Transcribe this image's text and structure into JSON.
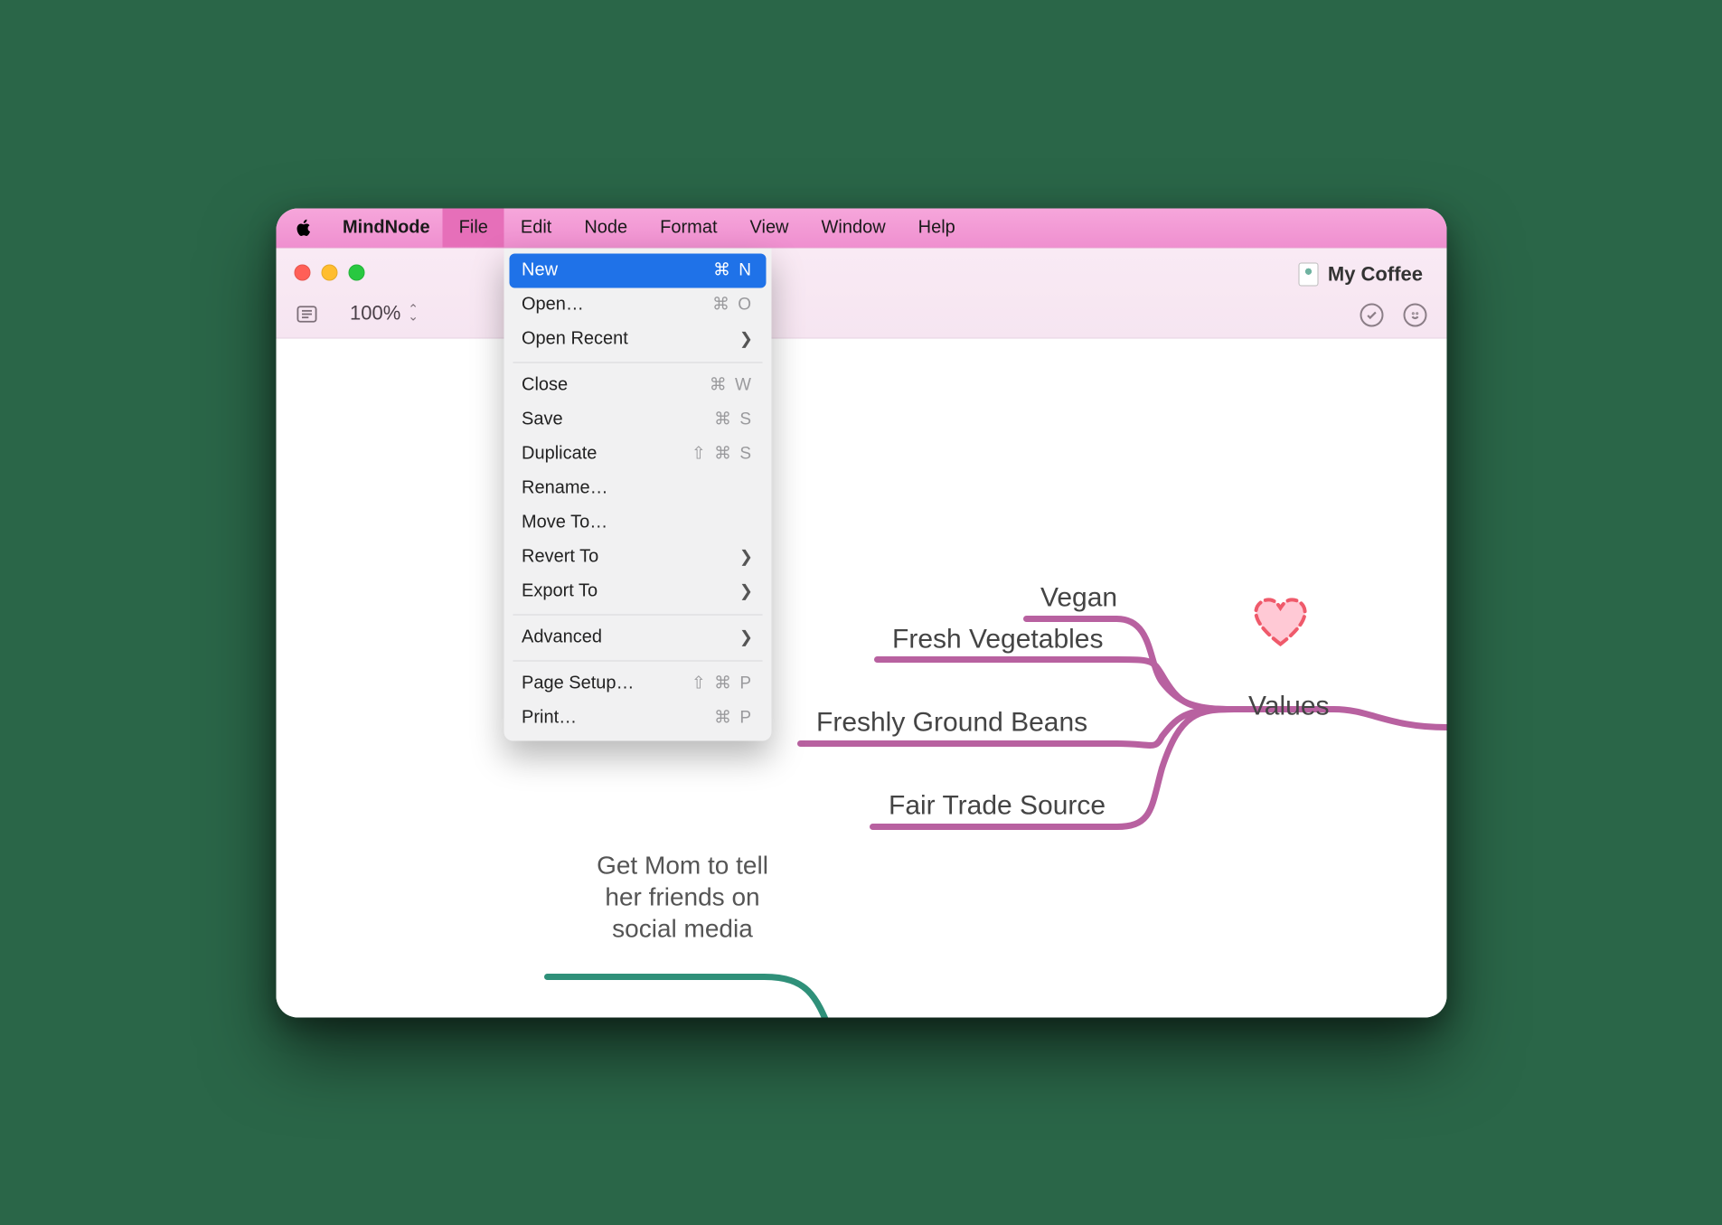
{
  "app": {
    "name": "MindNode"
  },
  "menubar": {
    "items": [
      "File",
      "Edit",
      "Node",
      "Format",
      "View",
      "Window",
      "Help"
    ],
    "active": "File"
  },
  "document": {
    "title": "My Coffee"
  },
  "toolbar": {
    "zoom": "100%"
  },
  "file_menu": {
    "items": [
      {
        "label": "New",
        "shortcut": "⌘ N",
        "highlighted": true
      },
      {
        "label": "Open…",
        "shortcut": "⌘ O"
      },
      {
        "label": "Open Recent",
        "submenu": true
      },
      {
        "sep": true
      },
      {
        "label": "Close",
        "shortcut": "⌘ W"
      },
      {
        "label": "Save",
        "shortcut": "⌘ S"
      },
      {
        "label": "Duplicate",
        "shortcut": "⇧ ⌘ S"
      },
      {
        "label": "Rename…"
      },
      {
        "label": "Move To…"
      },
      {
        "label": "Revert To",
        "submenu": true
      },
      {
        "label": "Export To",
        "submenu": true
      },
      {
        "sep": true
      },
      {
        "label": "Advanced",
        "submenu": true
      },
      {
        "sep": true
      },
      {
        "label": "Page Setup…",
        "shortcut": "⇧ ⌘ P"
      },
      {
        "label": "Print…",
        "shortcut": "⌘ P"
      }
    ]
  },
  "mindmap": {
    "parent": "Values",
    "children": [
      "Vegan",
      "Fresh Vegetables",
      "Freshly Ground Beans",
      "Fair Trade Source"
    ],
    "partial_caption_lines": [
      "Get Mom to tell",
      "her friends on",
      "social media"
    ],
    "colors": {
      "branch": "#b861a0",
      "alt_branch": "#2f9079",
      "heart_fill": "#ffc9d5",
      "heart_stroke": "#ef5a6b"
    }
  }
}
